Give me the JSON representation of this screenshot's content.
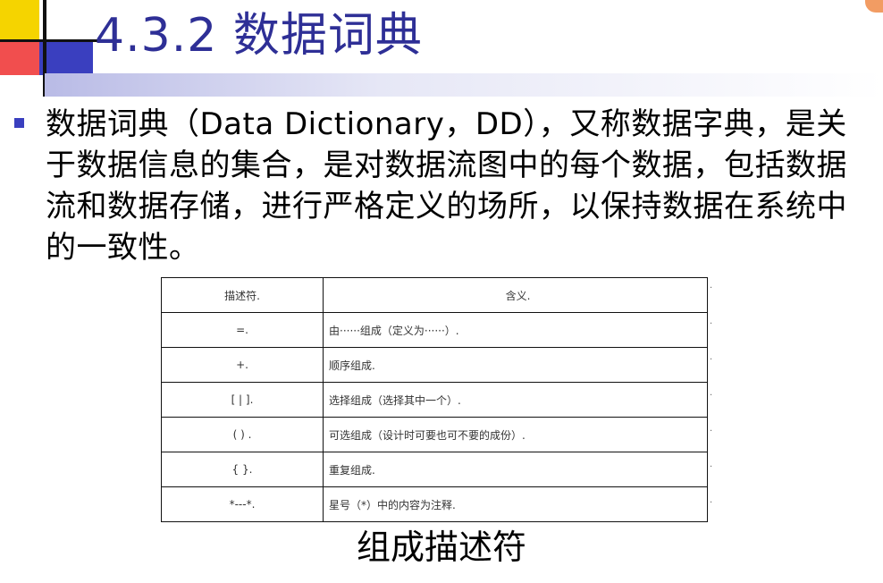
{
  "slide": {
    "title": "4.3.2 数据词典",
    "bullet_text": "数据词典（Data Dictionary，DD），又称数据字典，是关于数据信息的集合，是对数据流图中的每个数据，包括数据流和数据存储，进行严格定义的场所，以保持数据在系统中的一致性。",
    "caption": "组成描述符"
  },
  "table": {
    "headers": [
      "描述符.",
      "含义."
    ],
    "rows": [
      [
        "=.",
        "由······组成（定义为······）."
      ],
      [
        "+.",
        "顺序组成."
      ],
      [
        "[ | ].",
        "选择组成（选择其中一个）."
      ],
      [
        "( ) .",
        "可选组成（设计时可要也可不要的成份）."
      ],
      [
        "{ }.",
        "重复组成."
      ],
      [
        "*---*.",
        "星号（*）中的内容为注释."
      ]
    ],
    "margin_mark": "."
  },
  "colors": {
    "title": "#2e2f96",
    "bullet": "#3a3fbf",
    "deco_yellow": "#f5d400",
    "deco_red": "#f03b3b",
    "deco_blue": "#3a3fbf"
  }
}
